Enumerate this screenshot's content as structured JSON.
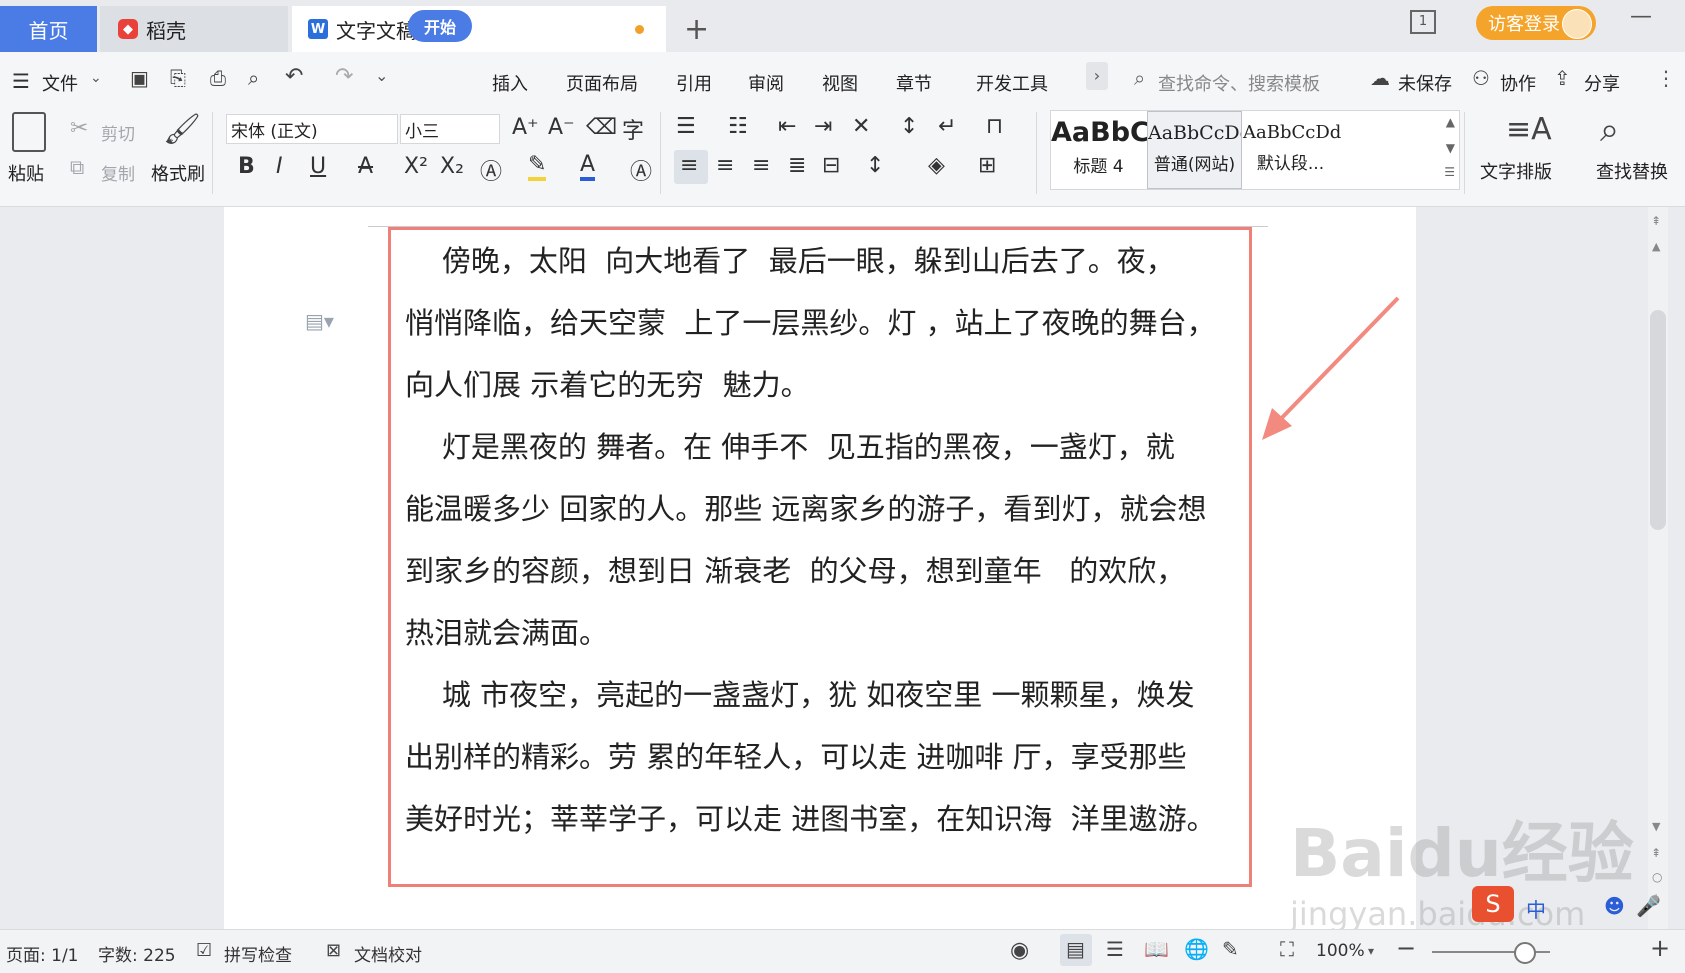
{
  "tabs": {
    "home": "首页",
    "daoke": "稻壳",
    "doc": "文字文稿1",
    "new_tab_icon": "plus-icon"
  },
  "window": {
    "login": "访客登录",
    "page_count_icon": "1"
  },
  "menu": {
    "file": "文件",
    "items": [
      "开始",
      "插入",
      "页面布局",
      "引用",
      "审阅",
      "视图",
      "章节",
      "开发工具"
    ],
    "search_placeholder": "查找命令、搜索模板",
    "unsaved": "未保存",
    "collab": "协作",
    "share": "分享"
  },
  "ribbon": {
    "paste": "粘贴",
    "cut": "剪切",
    "copy": "复制",
    "format_painter": "格式刷",
    "font_name": "宋体 (正文)",
    "font_size": "小三",
    "styles": [
      {
        "preview": "AaBbC",
        "name": "标题 4"
      },
      {
        "preview": "AaBbCcDd",
        "name": "普通(网站)"
      },
      {
        "preview": "AaBbCcDd",
        "name": "默认段..."
      }
    ],
    "text_layout": "文字排版",
    "find_replace": "查找替换"
  },
  "document": {
    "lines": [
      "    傍晚，太阳  向大地看了  最后一眼，躲到山后去了。夜，",
      "悄悄降临，给天空蒙  上了一层黑纱。灯 ，站上了夜晚的舞台，",
      "向人们展 示着它的无穷  魅力。",
      "    灯是黑夜的 舞者。在 伸手不  见五指的黑夜，一盏灯，就",
      "能温暖多少 回家的人。那些 远离家乡的游子，看到灯，就会想",
      "到家乡的容颜，想到日 渐衰老  的父母，想到童年   的欢欣，",
      "热泪就会满面。",
      "    城 市夜空，亮起的一盏盏灯，犹 如夜空里 一颗颗星，焕发",
      "出别样的精彩。劳 累的年轻人，可以走 进咖啡 厅，享受那些",
      "美好时光；莘莘学子，可以走 进图书室，在知识海  洋里遨游。"
    ]
  },
  "status": {
    "page": "页面: 1/1",
    "words": "字数: 225",
    "spell": "拼写检查",
    "proof": "文档校对",
    "zoom": "100%",
    "zoom_level": 0.5
  },
  "watermark": {
    "main": "Baidu经验",
    "sub": "jingyan.baidu.com"
  },
  "colors": {
    "accent": "#4b7be5",
    "highlight_box": "#f07f77",
    "login": "#f5a42b"
  }
}
